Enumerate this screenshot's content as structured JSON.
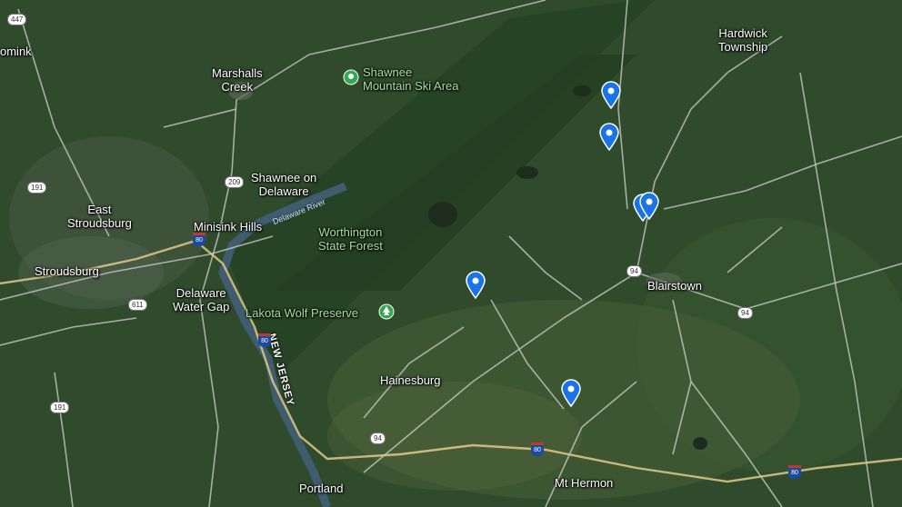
{
  "colors": {
    "pin": "#1a73e8",
    "park_poi": "#34a853",
    "road": "#cfcfcf"
  },
  "places": [
    {
      "id": "pomink",
      "text": "omink"
    },
    {
      "id": "marshalls",
      "text": "Marshalls\nCreek"
    },
    {
      "id": "shawnee-ski",
      "text": "Shawnee\nMountain Ski Area",
      "poi": "ski-icon"
    },
    {
      "id": "hardwick",
      "text": "Hardwick\nTownship"
    },
    {
      "id": "shawnee-del",
      "text": "Shawnee on\nDelaware"
    },
    {
      "id": "east-stroud",
      "text": "East\nStroudsburg"
    },
    {
      "id": "minisink",
      "text": "Minisink Hills"
    },
    {
      "id": "worthington",
      "text": "Worthington\nState Forest"
    },
    {
      "id": "stroudsburg",
      "text": "Stroudsburg"
    },
    {
      "id": "blairstown",
      "text": "Blairstown"
    },
    {
      "id": "del-water-gap",
      "text": "Delaware\nWater Gap"
    },
    {
      "id": "lakota",
      "text": "Lakota Wolf Preserve",
      "poi": "park-icon"
    },
    {
      "id": "hainesburg",
      "text": "Hainesburg"
    },
    {
      "id": "mt-hermon",
      "text": "Mt Hermon"
    },
    {
      "id": "portland",
      "text": "Portland"
    }
  ],
  "river_label": "Delaware River",
  "state_label": "NEW JERSEY",
  "shields": [
    "447",
    "209",
    "191",
    "611",
    "191",
    "94",
    "94",
    "94"
  ],
  "interstates": [
    "80",
    "80",
    "80",
    "80"
  ],
  "pins": [
    "pin-1",
    "pin-2",
    "pin-3",
    "pin-4",
    "pin-5",
    "pin-6"
  ]
}
